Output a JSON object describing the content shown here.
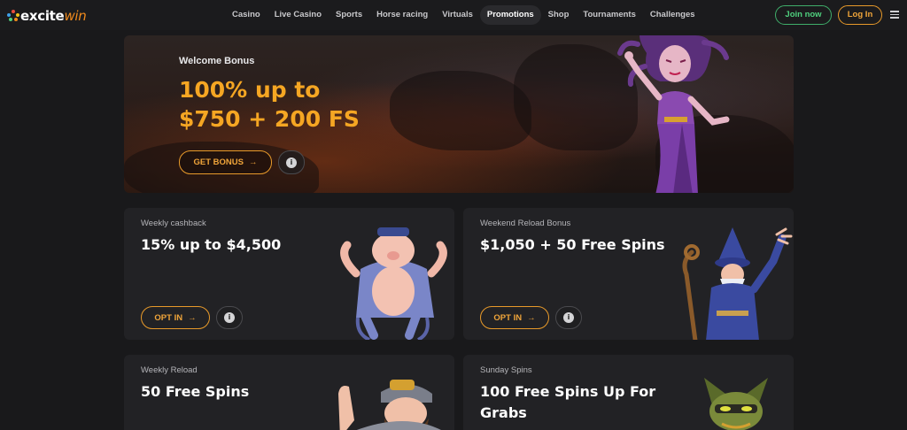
{
  "brand": {
    "logo_text_a": "excite",
    "logo_text_b": "win"
  },
  "nav": {
    "items": [
      {
        "label": "Casino",
        "active": false
      },
      {
        "label": "Live Casino",
        "active": false
      },
      {
        "label": "Sports",
        "active": false
      },
      {
        "label": "Horse racing",
        "active": false
      },
      {
        "label": "Virtuals",
        "active": false
      },
      {
        "label": "Promotions",
        "active": true
      },
      {
        "label": "Shop",
        "active": false
      },
      {
        "label": "Tournaments",
        "active": false
      },
      {
        "label": "Challenges",
        "active": false
      }
    ],
    "join_label": "Join now",
    "login_label": "Log In"
  },
  "hero": {
    "subtitle": "Welcome Bonus",
    "title_line1": "100% up to",
    "title_line2": "$750 + 200 FS",
    "cta_label": "GET BONUS",
    "cta_arrow": "→",
    "info_glyph": "i"
  },
  "cards": [
    {
      "subtitle": "Weekly cashback",
      "title": "15% up to $4,500",
      "cta_label": "OPT IN",
      "cta_arrow": "→",
      "info_glyph": "i"
    },
    {
      "subtitle": "Weekend Reload Bonus",
      "title": "$1,050 + 50 Free Spins",
      "cta_label": "OPT IN",
      "cta_arrow": "→",
      "info_glyph": "i"
    },
    {
      "subtitle": "Weekly Reload",
      "title": "50 Free Spins"
    },
    {
      "subtitle": "Sunday Spins",
      "title": "100 Free Spins Up For Grabs"
    }
  ],
  "colors": {
    "accent_orange": "#f5a623",
    "join_green": "#4fd07e",
    "page_bg": "#19191b",
    "card_bg": "#222225"
  },
  "icons": [
    "logo-mark-icon",
    "menu-icon",
    "arrow-right-icon",
    "info-icon"
  ]
}
